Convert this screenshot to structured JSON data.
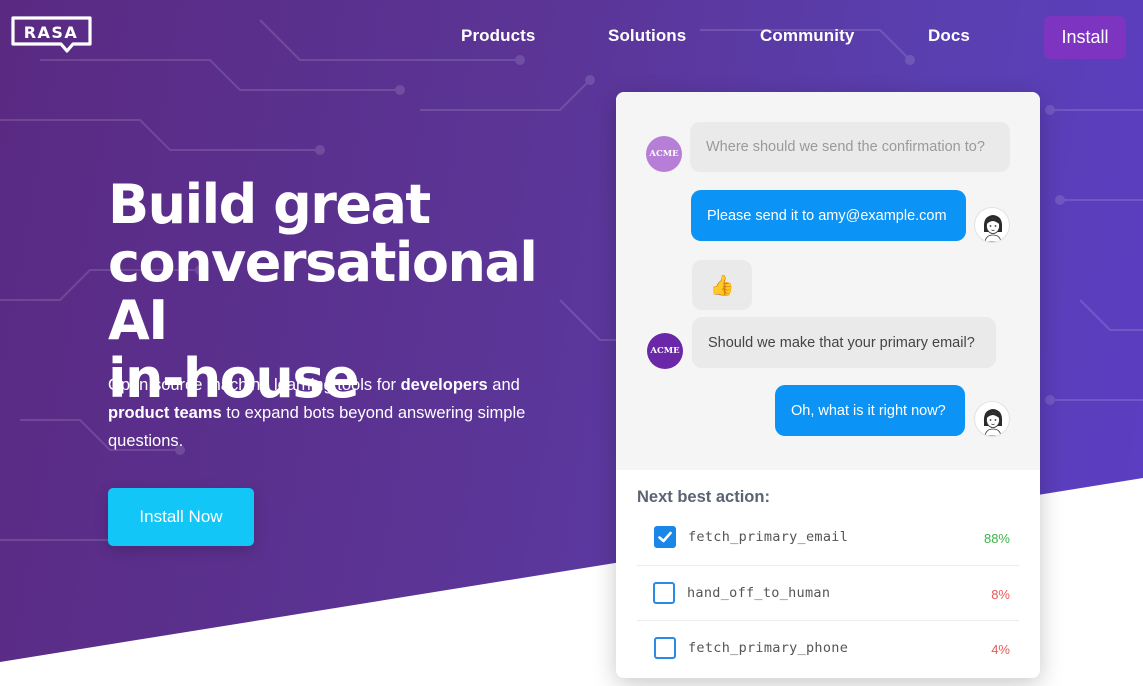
{
  "brand": {
    "logo_text": "RASA"
  },
  "nav": {
    "items": [
      {
        "label": "Products"
      },
      {
        "label": "Solutions"
      },
      {
        "label": "Community"
      },
      {
        "label": "Docs"
      }
    ],
    "install_label": "Install"
  },
  "hero": {
    "headline_lines": [
      "Build great",
      "conversational AI",
      "in-house"
    ],
    "sub_1": "Open source machine learning tools for ",
    "sub_bold_1": "developers",
    "sub_2": " and ",
    "sub_bold_2": "product teams",
    "sub_3": " to expand bots beyond answering simple questions.",
    "cta_label": "Install Now"
  },
  "chat": {
    "bot_avatar_text": "ACME",
    "messages": [
      {
        "from": "bot",
        "text": "Where should we send the confirmation to?"
      },
      {
        "from": "user",
        "text": "Please send it to amy@example.com"
      },
      {
        "from": "bot",
        "text": "👍"
      },
      {
        "from": "bot",
        "text": "Should we make that your primary email?"
      },
      {
        "from": "user",
        "text": "Oh, what is it right now?"
      }
    ]
  },
  "next_action": {
    "title": "Next best action:",
    "items": [
      {
        "name": "fetch_primary_email",
        "percent": "88%",
        "checked": true,
        "color": "#3cb44b"
      },
      {
        "name": "hand_off_to_human",
        "percent": "8%",
        "checked": false,
        "color": "#e85a5a"
      },
      {
        "name": "fetch_primary_phone",
        "percent": "4%",
        "checked": false,
        "color": "#e85a5a"
      }
    ]
  },
  "colors": {
    "accent_install": "#7d34c0",
    "cta": "#12c6f7",
    "user_bubble": "#0b93f6",
    "checkbox": "#1a86e8"
  }
}
